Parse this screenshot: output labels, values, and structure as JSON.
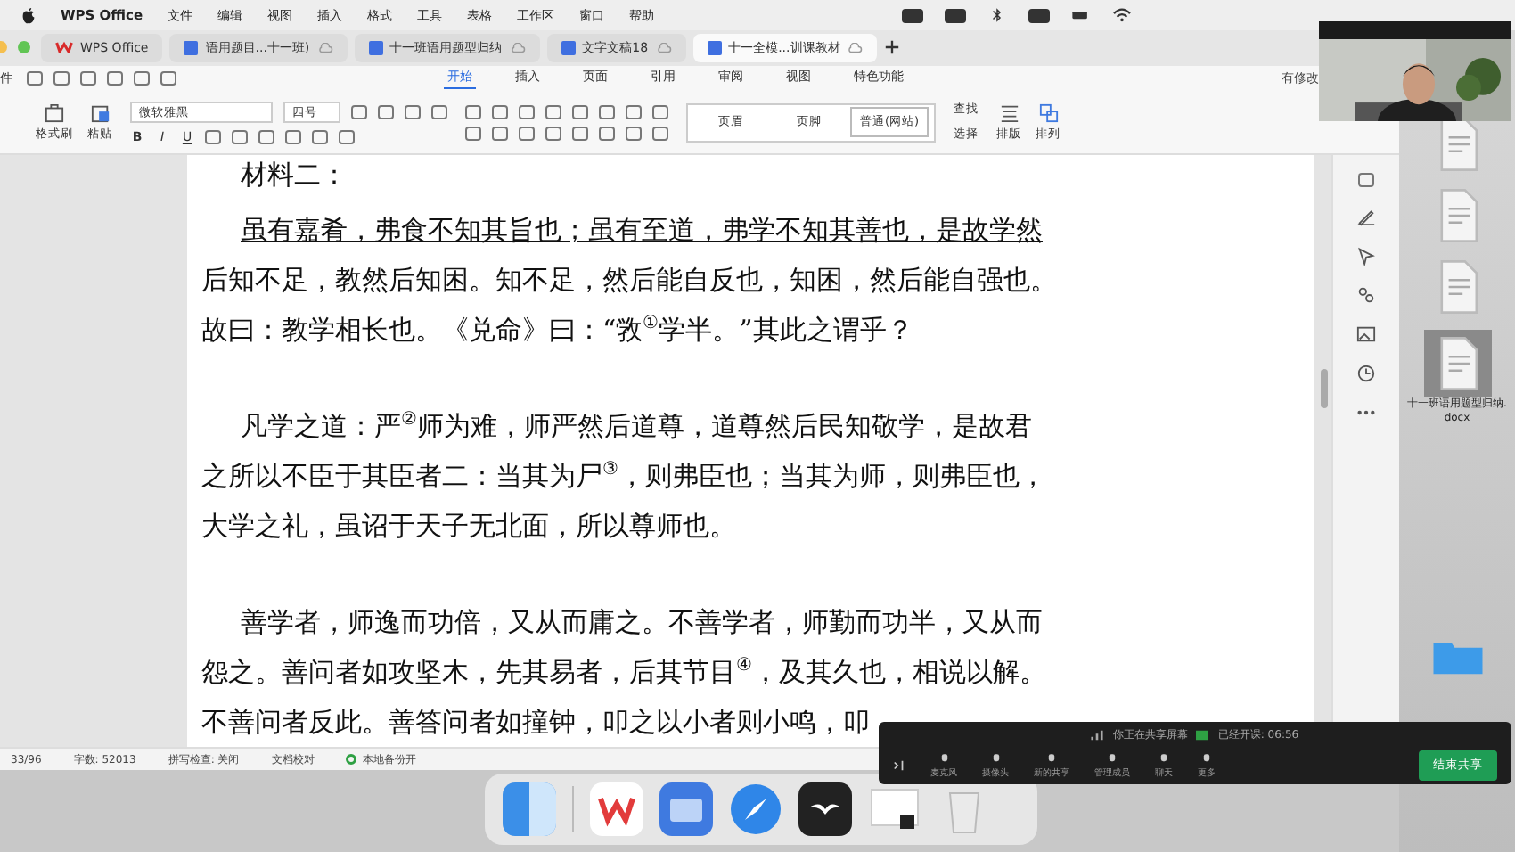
{
  "menu_bar": {
    "app_name": "WPS Office",
    "items": [
      "文件",
      "编辑",
      "视图",
      "插入",
      "格式",
      "工具",
      "表格",
      "工作区",
      "窗口",
      "帮助"
    ]
  },
  "tabs": [
    {
      "label": "WPS Office",
      "kind": "home",
      "selected": false
    },
    {
      "label": "语用题目...十一班)",
      "kind": "doc",
      "selected": false
    },
    {
      "label": "十一班语用题型归纳",
      "kind": "doc",
      "selected": false
    },
    {
      "label": "文字文稿18",
      "kind": "doc",
      "selected": false
    },
    {
      "label": "十一全模...训课教材",
      "kind": "doc",
      "selected": true
    }
  ],
  "file_menu_label": "件",
  "ribbon_tabs": [
    {
      "label": "开始",
      "selected": true
    },
    {
      "label": "插入",
      "selected": false
    },
    {
      "label": "页面",
      "selected": false
    },
    {
      "label": "引用",
      "selected": false
    },
    {
      "label": "审阅",
      "selected": false
    },
    {
      "label": "视图",
      "selected": false
    },
    {
      "label": "特色功能",
      "selected": false
    }
  ],
  "revision_status": "有修改",
  "ribbon": {
    "format_painter": "格式刷",
    "paste": "粘贴",
    "font": "微软雅黑",
    "font_size": "四号",
    "format_buttons": [
      "B",
      "I",
      "U"
    ],
    "styles": [
      {
        "label": "页眉",
        "selected": false
      },
      {
        "label": "页脚",
        "selected": false
      },
      {
        "label": "普通(网站)",
        "selected": true
      }
    ],
    "find": "查找",
    "select": "选择",
    "layout": "排版",
    "arrange": "排列"
  },
  "document": {
    "paragraphs": [
      {
        "lines": [
          {
            "text": "材料二：",
            "underlined": false
          }
        ]
      },
      {
        "lines": [
          {
            "text": "虽有嘉肴，弗食不知其旨也；虽有至道，弗学不知其善也，是故学然",
            "underlined": true
          },
          {
            "text": "后知不足，教然后知困。知不足，然后能自反也，知困，然后能自强也。",
            "underlined": false
          },
          {
            "text": "故曰：教学相长也。《兑命》曰：“敩$^{①}$学半。”其此之谓乎？",
            "underlined": false
          }
        ]
      },
      {
        "lines": [
          {
            "text": "凡学之道：严$^{②}$师为难，师严然后道尊，道尊然后民知敬学，是故君",
            "underlined": false
          },
          {
            "text": "之所以不臣于其臣者二：当其为尸$^{③}$，则弗臣也；当其为师，则弗臣也，",
            "underlined": false
          },
          {
            "text": "大学之礼，虽诏于天子无北面，所以尊师也。",
            "underlined": false
          }
        ]
      },
      {
        "lines": [
          {
            "text": "善学者，师逸而功倍，又从而庸之。不善学者，师勤而功半，又从而",
            "underlined": false
          },
          {
            "text": "怨之。善问者如攻坚木，先其易者，后其节目$^{④}$，及其久也，相说以解。",
            "underlined": false
          },
          {
            "text": "不善问者反此。善答问者如撞钟，叩之以小者则小鸣，叩",
            "underlined": false
          }
        ]
      }
    ]
  },
  "status_bar": {
    "page": "33/96",
    "word_count": "字数: 52013",
    "spell_check": "拼写检查: 关闭",
    "proofread": "文档校对",
    "backup": "本地备份开"
  },
  "desktop_files": [
    {
      "kind": "docx"
    },
    {
      "kind": "docx"
    },
    {
      "kind": "docx"
    },
    {
      "kind": "docx-selected",
      "label": "十一班语用题型归纳.docx"
    },
    {
      "kind": "folder"
    }
  ],
  "meeting_bar": {
    "status": "你正在共享屏幕",
    "elapsed": "已经开课: 06:56",
    "buttons": [
      {
        "label": "麦克风"
      },
      {
        "label": "摄像头"
      },
      {
        "label": "新的共享"
      },
      {
        "label": "管理成员"
      },
      {
        "label": "聊天"
      },
      {
        "label": "更多"
      }
    ],
    "end_button": "结束共享"
  }
}
